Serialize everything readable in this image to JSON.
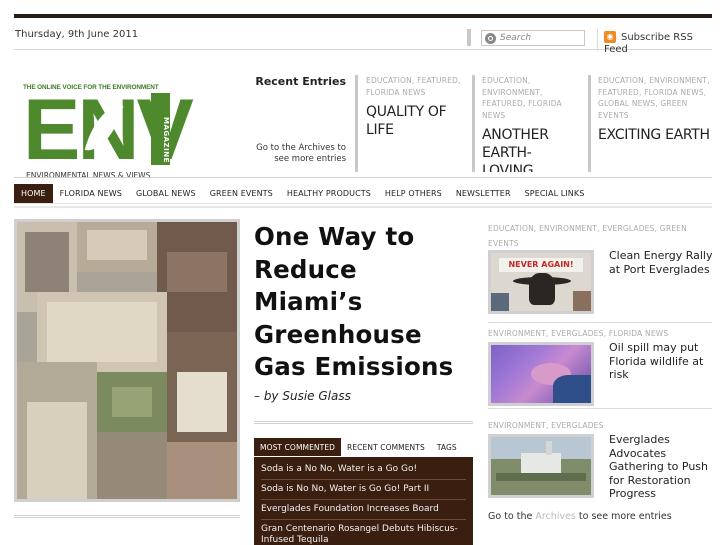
{
  "header": {
    "date": "Thursday, 9th June 2011",
    "search_placeholder": "Search",
    "rss_label": "Subscribe RSS Feed"
  },
  "logo": {
    "tagline": "THE ONLINE VOICE FOR THE ENVIRONMENT",
    "letters": "ENV",
    "magazine": "MAGAZINE",
    "subtitle": "ENVIRONMENTAL NEWS & VIEWS",
    "colors": {
      "green": "#4e8a2d"
    }
  },
  "recent": {
    "title": "Recent Entries",
    "archives_note": "Go to the Archives to see more entries",
    "entries": [
      {
        "cats": "EDUCATION, FEATURED, FLORIDA NEWS",
        "title": "QUALITY OF LIFE"
      },
      {
        "cats": "EDUCATION, ENVIRONMENT, FEATURED, FLORIDA NEWS",
        "title": "ANOTHER EARTH-LOVING"
      },
      {
        "cats": "EDUCATION, ENVIRONMENT, FEATURED, FLORIDA NEWS, GLOBAL NEWS, GREEN EVENTS",
        "title": "EXCITING EARTH"
      }
    ]
  },
  "nav": {
    "items": [
      "HOME",
      "FLORIDA NEWS",
      "GLOBAL NEWS",
      "GREEN EVENTS",
      "HEALTHY PRODUCTS",
      "HELP OTHERS",
      "NEWSLETTER",
      "SPECIAL LINKS"
    ],
    "active_color": "#3a1e10"
  },
  "feature": {
    "headline": "One Way to Reduce Miami’s Greenhouse Gas Emissions",
    "byline": "– by Susie Glass"
  },
  "tabs": {
    "labels": [
      "MOST COMMENTED",
      "RECENT COMMENTS",
      "TAGS"
    ],
    "items": [
      "Soda is a No No, Water is a Go Go!",
      "Soda is No No, Water is Go Go! Part II",
      "Everglades Foundation Increases Board",
      "Gran Centenario Rosangel Debuts Hibiscus-Infused Tequila"
    ]
  },
  "sidebar": {
    "posts": [
      {
        "cats": "EDUCATION, ENVIRONMENT, EVERGLADES, GREEN EVENTS",
        "title": "Clean Energy Rally at Port Everglades",
        "sign_text": "NEVER AGAIN!"
      },
      {
        "cats": "ENVIRONMENT, EVERGLADES, FLORIDA NEWS",
        "title": "Oil spill may put Florida wildlife at risk"
      },
      {
        "cats": "ENVIRONMENT, EVERGLADES",
        "title": "Everglades Advocates Gathering to Push for Restoration Progress"
      }
    ],
    "goto_prefix": "Go to the",
    "goto_link": "Archives",
    "goto_suffix": "to see more entries"
  }
}
